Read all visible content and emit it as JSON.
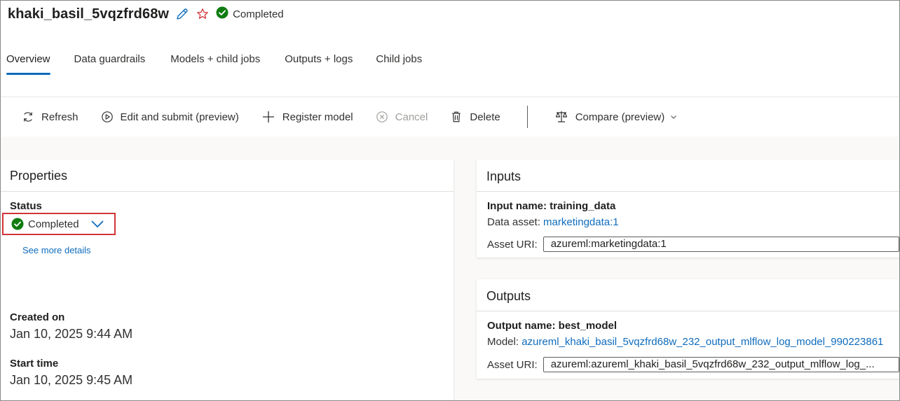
{
  "header": {
    "job_title": "khaki_basil_5vqzfrd68w",
    "status": "Completed",
    "edit_icon": "pencil-icon",
    "favorite_icon": "star-icon"
  },
  "tabs": [
    {
      "label": "Overview",
      "active": true
    },
    {
      "label": "Data guardrails",
      "active": false
    },
    {
      "label": "Models + child jobs",
      "active": false
    },
    {
      "label": "Outputs + logs",
      "active": false
    },
    {
      "label": "Child jobs",
      "active": false
    }
  ],
  "toolbar": {
    "refresh": "Refresh",
    "edit_submit": "Edit and submit (preview)",
    "register_model": "Register model",
    "cancel": "Cancel",
    "delete": "Delete",
    "compare": "Compare (preview)"
  },
  "properties": {
    "title": "Properties",
    "status_label": "Status",
    "status_value": "Completed",
    "see_more": "See more details",
    "created_label": "Created on",
    "created_value": "Jan 10, 2025 9:44 AM",
    "start_label": "Start time",
    "start_value": "Jan 10, 2025 9:45 AM"
  },
  "inputs": {
    "title": "Inputs",
    "name_line": "Input name: training_data",
    "asset_label": "Data asset:",
    "asset_link": "marketingdata:1",
    "uri_label": "Asset URI:",
    "uri_value": "azureml:marketingdata:1"
  },
  "outputs": {
    "title": "Outputs",
    "name_line": "Output name: best_model",
    "model_label": "Model:",
    "model_link": "azureml_khaki_basil_5vqzfrd68w_232_output_mlflow_log_model_990223861",
    "uri_label": "Asset URI:",
    "uri_value": "azureml:azureml_khaki_basil_5vqzfrd68w_232_output_mlflow_log_..."
  },
  "colors": {
    "accent": "#0f6cbd",
    "success": "#107c10",
    "highlight": "#d13438",
    "star": "#d13438"
  }
}
